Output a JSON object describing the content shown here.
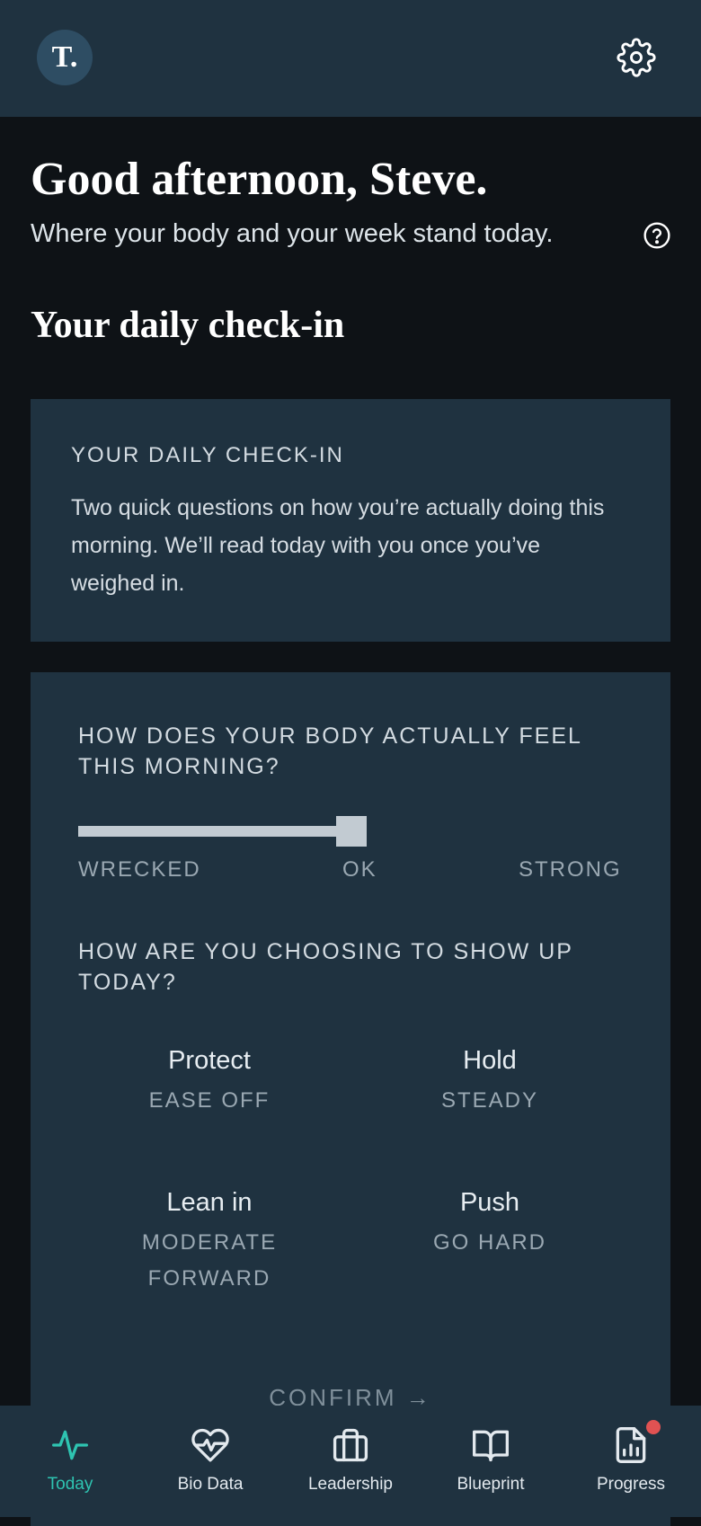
{
  "header": {
    "logo_text": "T.",
    "settings_icon": "gear-icon"
  },
  "greeting": "Good afternoon, Steve.",
  "subtitle": "Where your body and your week stand today.",
  "help_icon": "question-circle-icon",
  "section_title": "Your daily check-in",
  "intro_card": {
    "eyebrow": "YOUR DAILY CHECK-IN",
    "body": "Two quick questions on how you’re actually doing this morning. We’ll read today with you once you’ve weighed in."
  },
  "checkin": {
    "question1": "HOW DOES YOUR BODY ACTUALLY FEEL THIS MORNING?",
    "slider": {
      "labels": [
        "WRECKED",
        "OK",
        "STRONG"
      ],
      "value": 0.5
    },
    "question2": "HOW ARE YOU CHOOSING TO SHOW UP TODAY?",
    "choices": [
      {
        "name": "Protect",
        "sub": "EASE OFF"
      },
      {
        "name": "Hold",
        "sub": "STEADY"
      },
      {
        "name": "Lean in",
        "sub": "MODERATE FORWARD"
      },
      {
        "name": "Push",
        "sub": "GO HARD"
      }
    ],
    "confirm_label": "CONFIRM →"
  },
  "nav": {
    "items": [
      {
        "label": "Today",
        "icon": "pulse-icon",
        "active": true
      },
      {
        "label": "Bio Data",
        "icon": "heart-pulse-icon"
      },
      {
        "label": "Leadership",
        "icon": "briefcase-icon"
      },
      {
        "label": "Blueprint",
        "icon": "book-icon"
      },
      {
        "label": "Progress",
        "icon": "report-chart-icon",
        "badge": true
      }
    ]
  },
  "colors": {
    "accent": "#2ec4b1",
    "surface": "#1f3240",
    "background": "#0e1216",
    "badge": "#e05252"
  }
}
